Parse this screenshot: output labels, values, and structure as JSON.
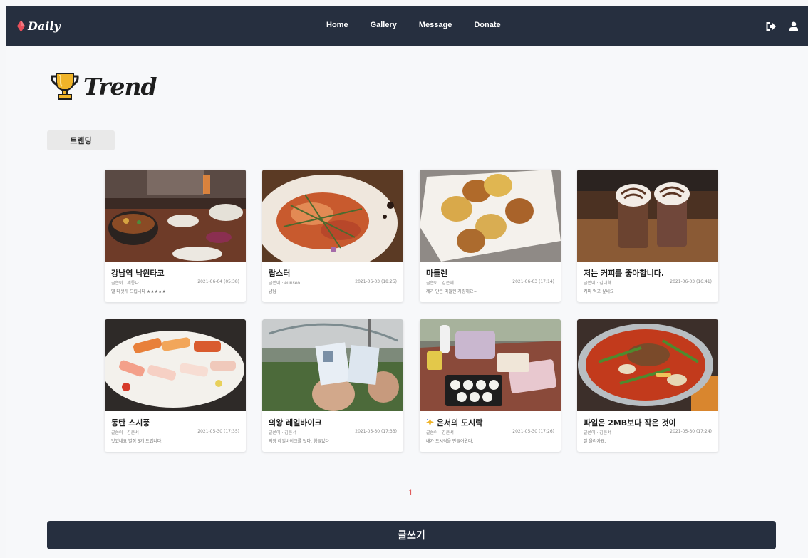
{
  "navbar": {
    "brand": "Daily",
    "links": [
      "Home",
      "Gallery",
      "Message",
      "Donate"
    ],
    "icons": [
      "logout-icon",
      "user-icon"
    ]
  },
  "page": {
    "heading": "Trend",
    "heading_icon": "trophy-icon",
    "tag_button": "트렌딩"
  },
  "cards": [
    {
      "title": "강남역 낙원타코",
      "author": "글쓴이 · 세롱다",
      "date": "2021-06-04 (05:38)",
      "desc": "별 다섯개 드립니다 ★★★★★",
      "image": "tacos-on-table-photo"
    },
    {
      "title": "랍스터",
      "author": "글쓴이 · eunseo",
      "date": "2021-06-03 (18:25)",
      "desc": "냠냠",
      "image": "lobster-dish-photo"
    },
    {
      "title": "마들렌",
      "author": "글쓴이 · 김은혜",
      "date": "2021-06-03 (17:14)",
      "desc": "제가 만든 마들렌 자랑해요~",
      "image": "madeleines-plate-photo"
    },
    {
      "title": "저는 커피를 좋아합니다.",
      "author": "글쓴이 · 김대혁",
      "date": "2021-06-03 (16:41)",
      "desc": "커피 먹고 싶네요",
      "image": "coffee-drinks-photo"
    },
    {
      "title": "동탄 스시풍",
      "author": "글쓴이 · 김은서",
      "date": "2021-05-30 (17:35)",
      "desc": "맛있네요 별점 5개 드립니다.",
      "image": "sushi-plate-photo"
    },
    {
      "title": "의왕 레일바이크",
      "author": "글쓴이 · 김은서",
      "date": "2021-05-30 (17:33)",
      "desc": "의왕 레일바이크를 탔다. 힘들었다",
      "image": "rail-bike-tickets-photo"
    },
    {
      "title": "은서의 도시락",
      "author": "글쓴이 · 김은서",
      "date": "2021-05-30 (17:26)",
      "desc": "내가 도시락을 만들어왔다.",
      "image": "lunchbox-picnic-photo",
      "emoji": "sparkle-icon"
    },
    {
      "title": "파일은 2MB보다 작은 것이",
      "author": "글쓴이 · 김은서",
      "date": "2021-05-30 (17:24)",
      "desc": "잘 올라가요.",
      "image": "spicy-stew-photo"
    }
  ],
  "pagination": {
    "current": "1"
  },
  "write_button": "글쓰기",
  "colors": {
    "navbar": "#262f3f",
    "brand_accent": "#e8505b",
    "trophy": "#f0b429",
    "page_number": "#e05a5a"
  }
}
